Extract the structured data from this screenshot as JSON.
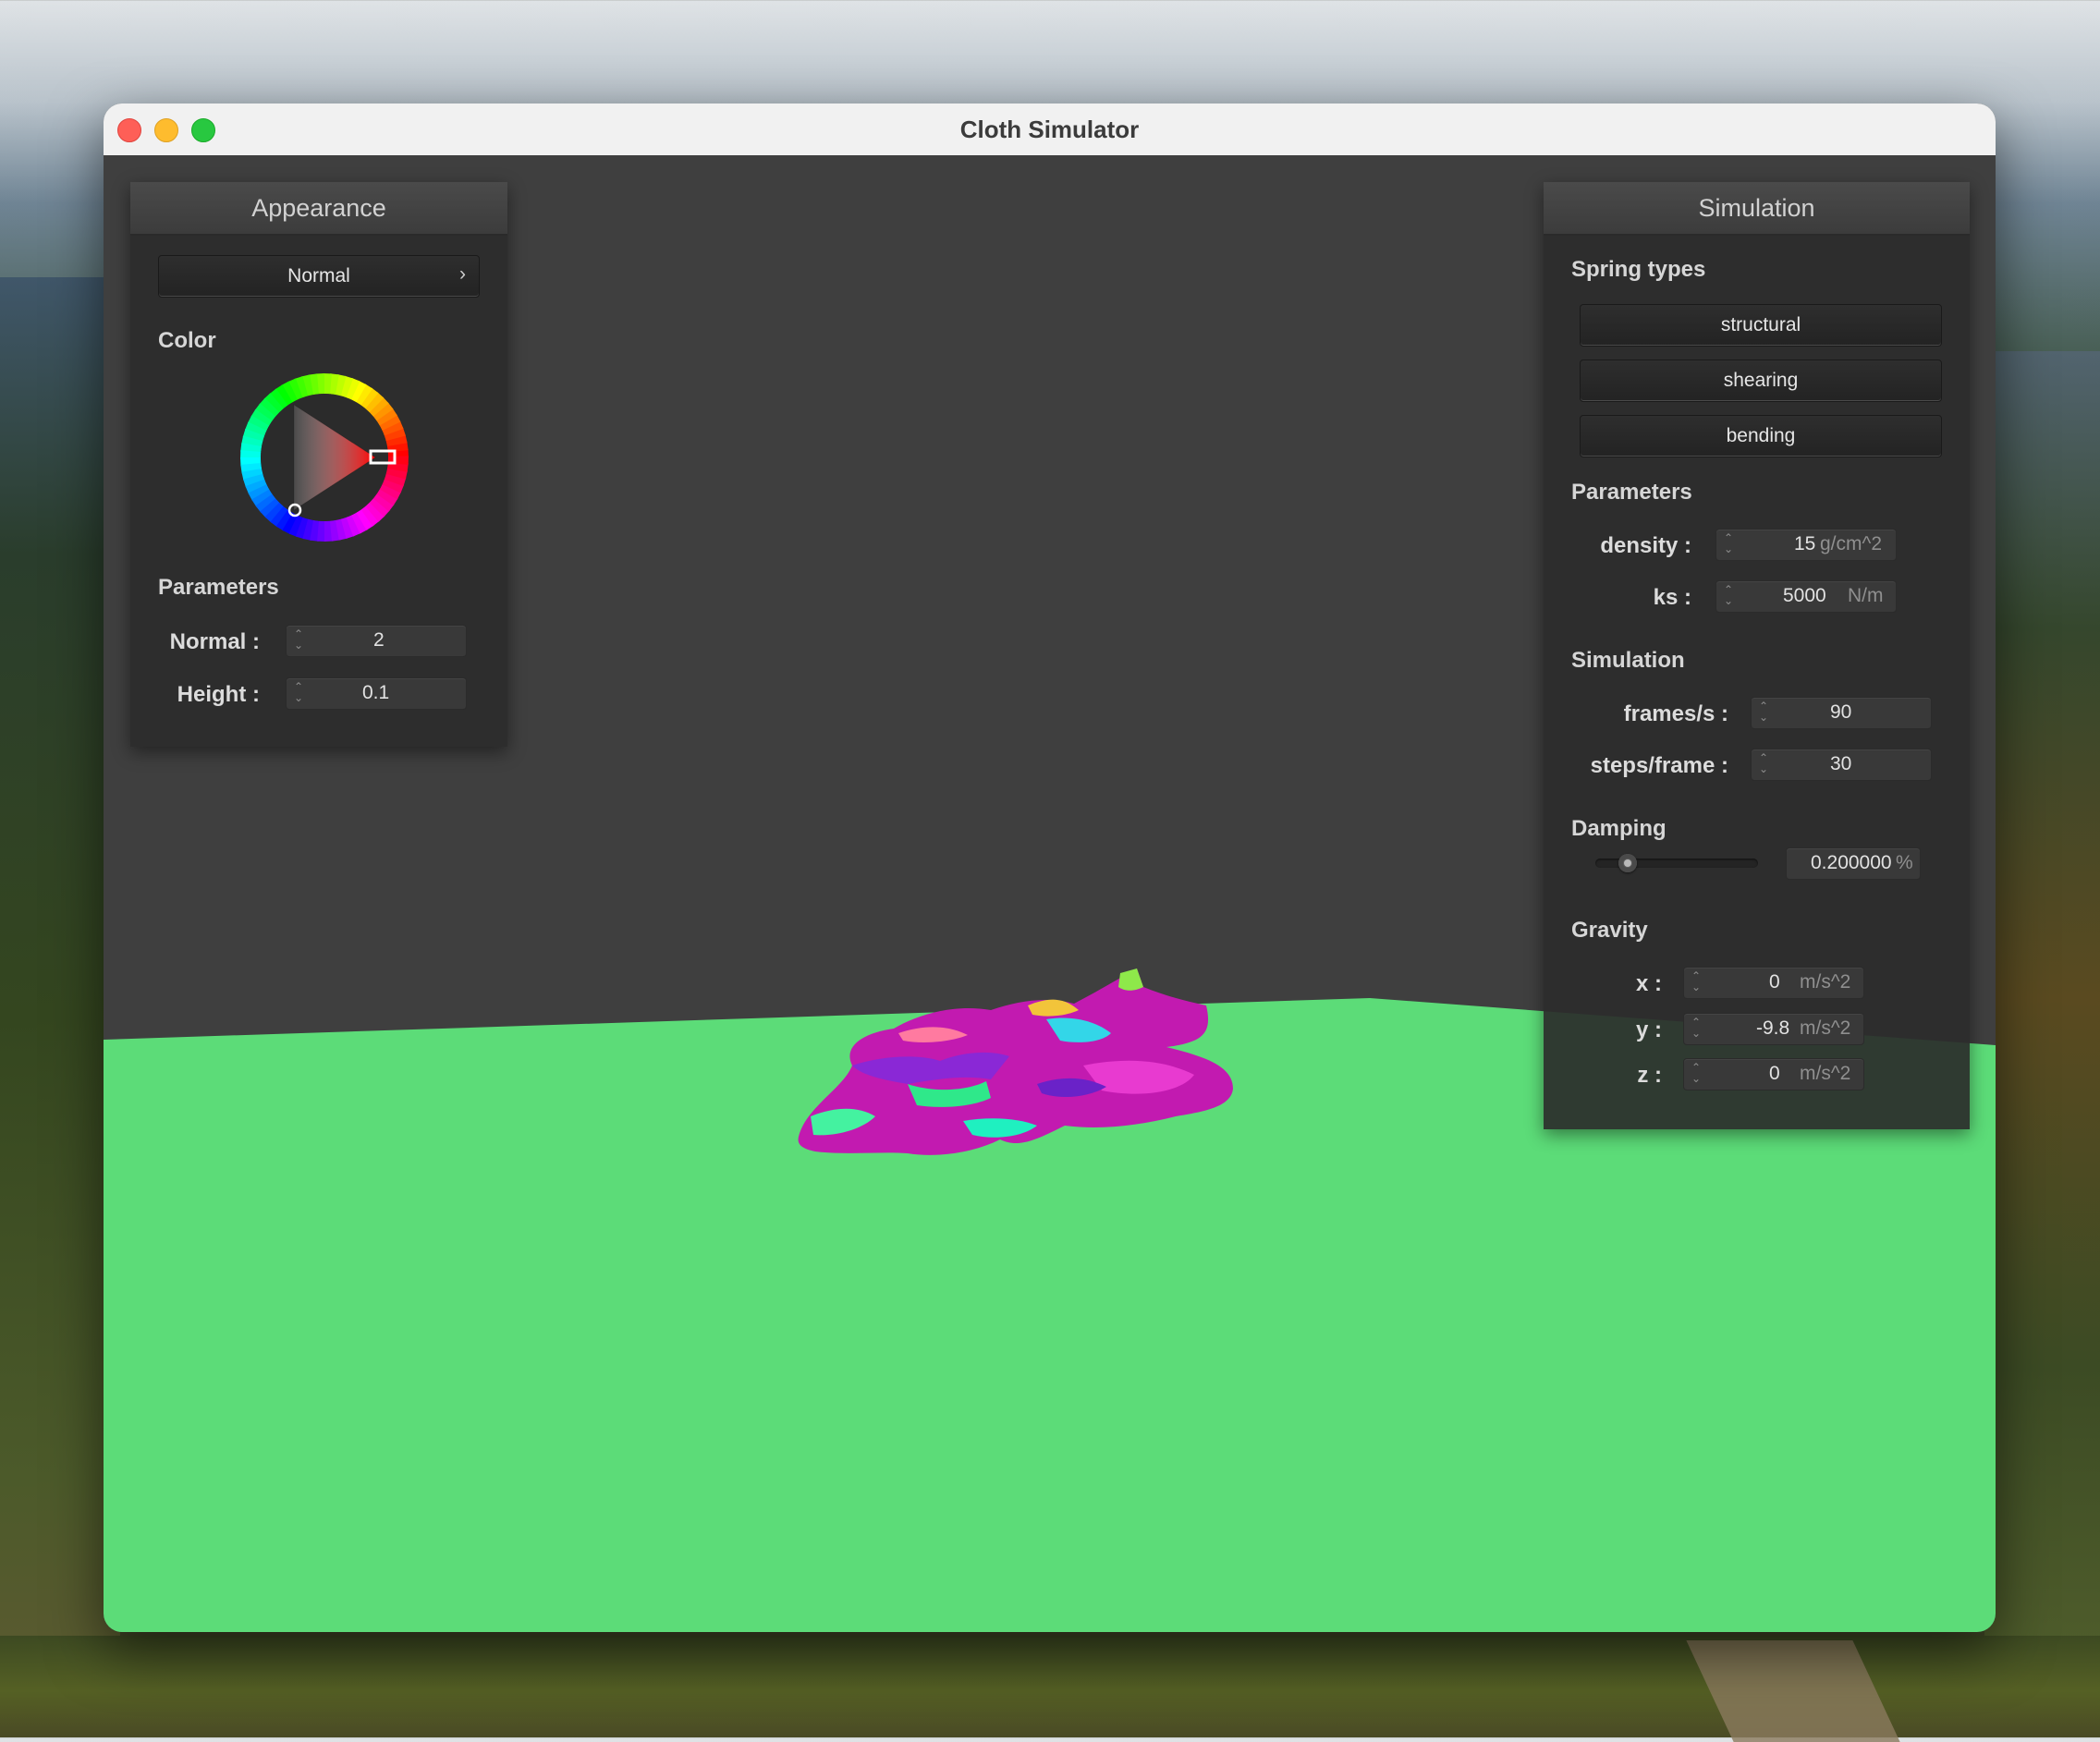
{
  "window": {
    "title": "Cloth Simulator"
  },
  "appearance": {
    "header": "Appearance",
    "shader_select": {
      "value": "Normal",
      "chevron": "›"
    },
    "color_label": "Color",
    "color_value": "#ff0000",
    "parameters_label": "Parameters",
    "normal": {
      "label": "Normal :",
      "value": "2"
    },
    "height": {
      "label": "Height :",
      "value": "0.1"
    }
  },
  "simulation": {
    "header": "Simulation",
    "spring_types_label": "Spring types",
    "springs": [
      "structural",
      "shearing",
      "bending"
    ],
    "parameters_label": "Parameters",
    "density": {
      "label": "density :",
      "value": "15",
      "unit": "g/cm^2"
    },
    "ks": {
      "label": "ks :",
      "value": "5000",
      "unit": "N/m"
    },
    "simulation_label": "Simulation",
    "frames": {
      "label": "frames/s :",
      "value": "90"
    },
    "steps": {
      "label": "steps/frame :",
      "value": "30"
    },
    "damping_label": "Damping",
    "damping": {
      "value": "0.200000",
      "unit": "%",
      "slider_fraction": 0.2
    },
    "gravity_label": "Gravity",
    "gravity": {
      "x": {
        "label": "x :",
        "value": "0",
        "unit": "m/s^2"
      },
      "y": {
        "label": "y :",
        "value": "-9.8",
        "unit": "m/s^2"
      },
      "z": {
        "label": "z :",
        "value": "0",
        "unit": "m/s^2"
      }
    }
  },
  "colors": {
    "floor": "#5cdc78",
    "viewport_bg": "#3f3f3f",
    "cloth_primary": "#c81cb4"
  }
}
